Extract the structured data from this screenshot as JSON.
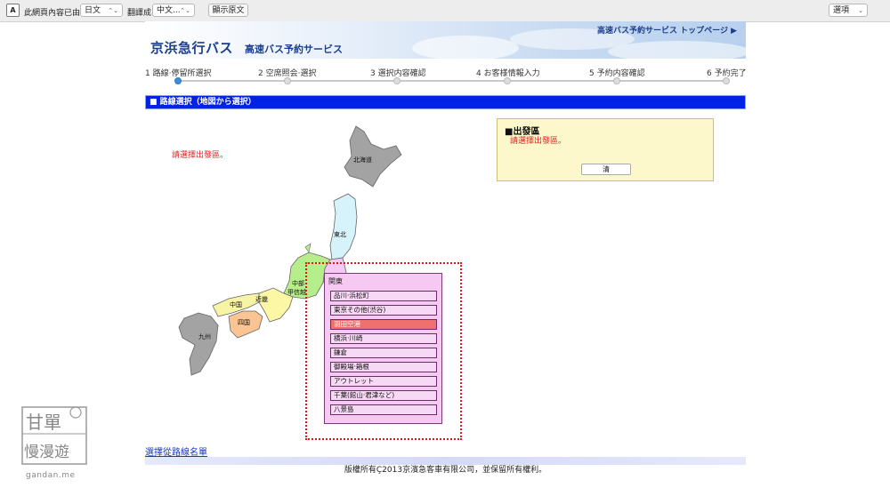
{
  "translate_bar": {
    "label": "此網頁內容已由",
    "source_lang": "日文",
    "translate_label": "翻譯成",
    "target_lang": "中文...",
    "show_original": "顯示原文",
    "options": "選項"
  },
  "header": {
    "brand": "京浜急行バス",
    "subtitle": "高速バス予約サービス",
    "top_link": "高速バス予約サービス トップページ ▶"
  },
  "steps": [
    {
      "label": "1 路線·停留所選択"
    },
    {
      "label": "2 空席照会·選択"
    },
    {
      "label": "3 選択内容確認"
    },
    {
      "label": "4 お客様情報入力"
    },
    {
      "label": "5 予約内容確認"
    },
    {
      "label": "6 予約完了"
    }
  ],
  "section_title": "■ 路線選択（地図から選択）",
  "prompt": "請選擇出發區。",
  "origin": {
    "title": "■出發區",
    "message": "請選擇出發區。",
    "clear": "清"
  },
  "map": {
    "regions": {
      "hokkaido": "北海道",
      "tohoku": "東北",
      "chubu_1": "中部",
      "chubu_2": "甲信越",
      "kinki": "近畿",
      "chugoku": "中国",
      "shikoku": "四国",
      "kyushu": "九州"
    }
  },
  "kanto": {
    "title": "関東",
    "stops": [
      {
        "label": "品川·浜松町",
        "selected": false
      },
      {
        "label": "東京その他(渋谷)",
        "selected": false
      },
      {
        "label": "羽田空港",
        "selected": true
      },
      {
        "label": "横浜·川崎",
        "selected": false
      },
      {
        "label": "鎌倉",
        "selected": false
      },
      {
        "label": "御殿場·箱根",
        "selected": false
      },
      {
        "label": "アウトレット",
        "selected": false
      },
      {
        "label": "千葉(館山·君津など)",
        "selected": false
      },
      {
        "label": "八景島",
        "selected": false
      }
    ]
  },
  "footer": {
    "list_link": "選擇從路線名單",
    "copyright": "版權所有Ç2013京濱急客車有限公司，並保留所有權利。"
  },
  "watermark": {
    "line1": "甘單",
    "line2": "慢漫遊",
    "site": "gandan.me"
  }
}
